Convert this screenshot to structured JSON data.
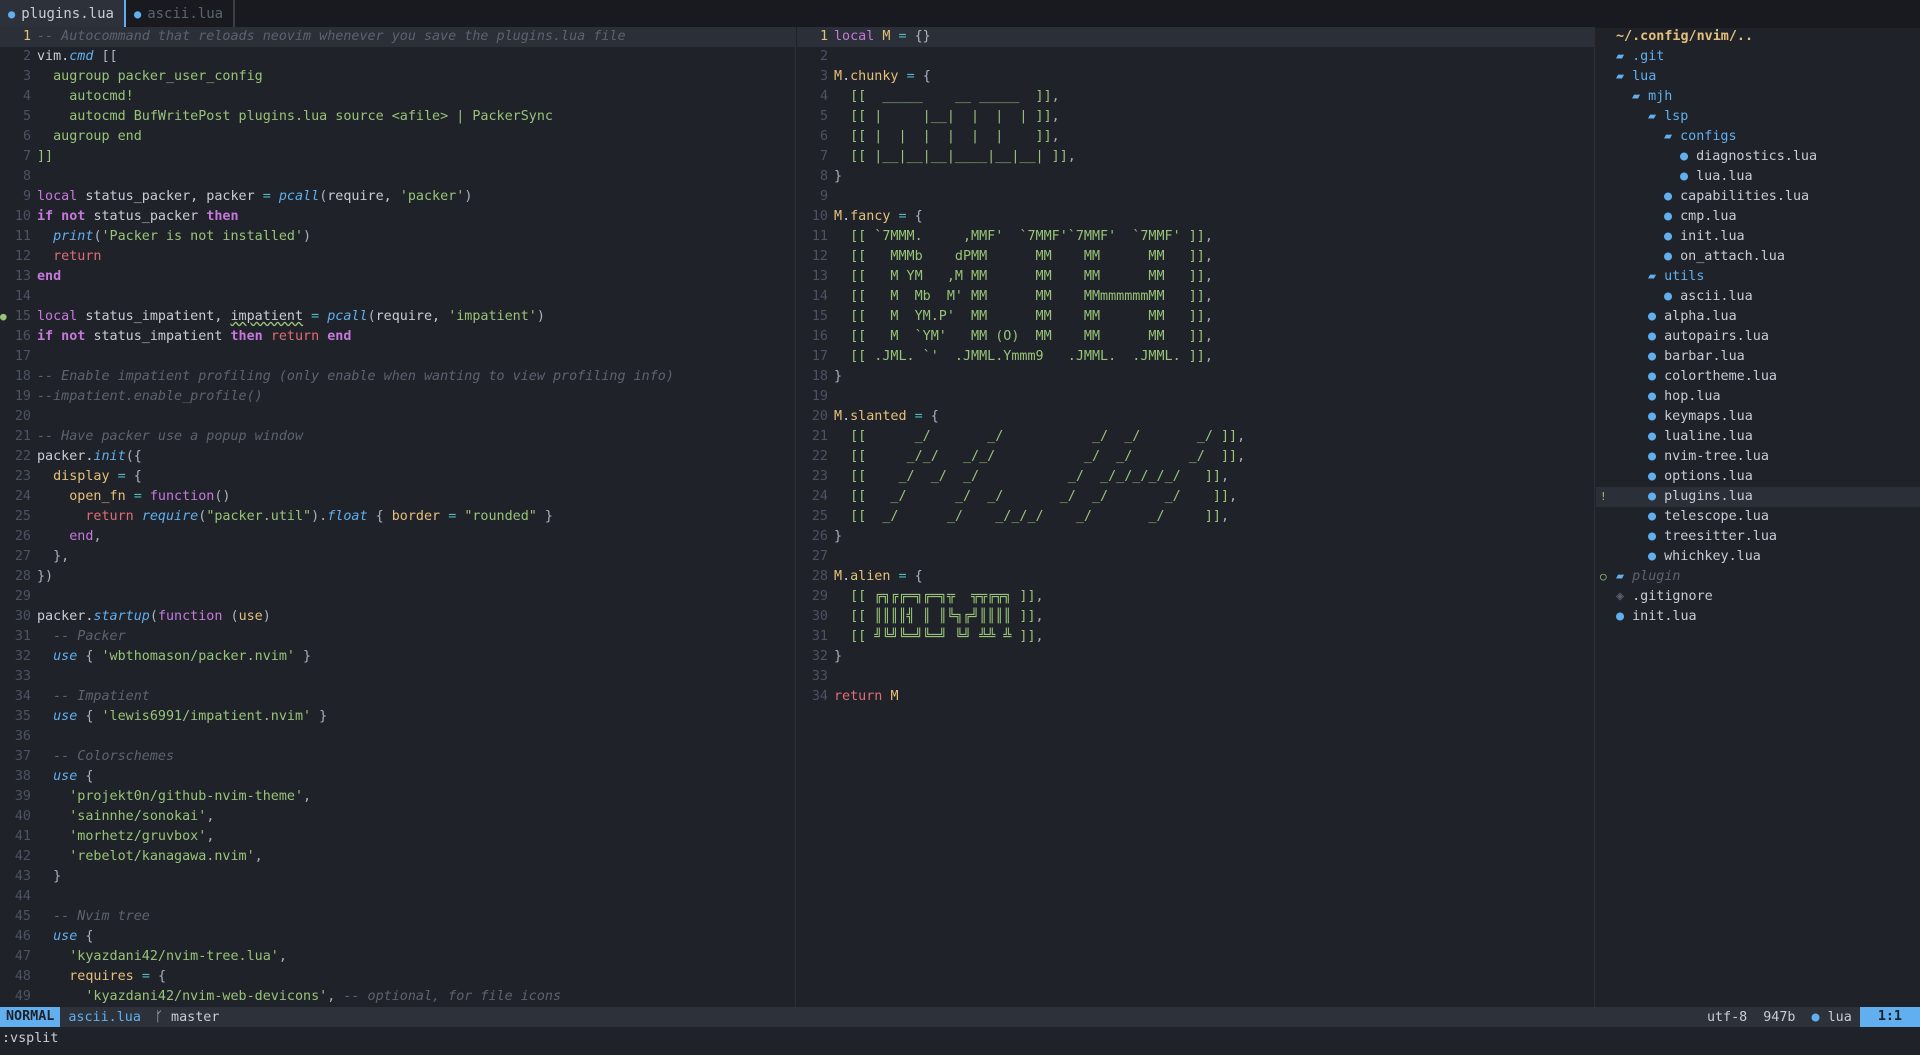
{
  "tabs": [
    {
      "label": "plugins.lua",
      "icon": "lua-icon",
      "active": true
    },
    {
      "label": "ascii.lua",
      "icon": "lua-icon",
      "active": false
    }
  ],
  "left_lines": [
    [
      [
        "c-comment",
        "-- Autocommand that reloads neovim whenever you save the plugins.lua file"
      ]
    ],
    [
      [
        "c-var",
        "vim."
      ],
      [
        "c-fn",
        "cmd"
      ],
      [
        "c-punc",
        " [["
      ]
    ],
    [
      [
        "c-str",
        "  augroup packer_user_config"
      ]
    ],
    [
      [
        "c-str",
        "    autocmd!"
      ]
    ],
    [
      [
        "c-str",
        "    autocmd BufWritePost plugins.lua source <afile> | PackerSync"
      ]
    ],
    [
      [
        "c-str",
        "  augroup end"
      ]
    ],
    [
      [
        "c-str",
        "]]"
      ]
    ],
    [],
    [
      [
        "c-kw",
        "local "
      ],
      [
        "c-var",
        "status_packer, packer "
      ],
      [
        "c-op",
        "= "
      ],
      [
        "c-fn",
        "pcall"
      ],
      [
        "c-punc",
        "("
      ],
      [
        "c-var",
        "require, "
      ],
      [
        "c-str",
        "'packer'"
      ],
      [
        "c-punc",
        ")"
      ]
    ],
    [
      [
        "c-kwb",
        "if not "
      ],
      [
        "c-var",
        "status_packer "
      ],
      [
        "c-kwb",
        "then"
      ]
    ],
    [
      [
        "c-var",
        "  "
      ],
      [
        "c-fn",
        "print"
      ],
      [
        "c-punc",
        "("
      ],
      [
        "c-str",
        "'Packer is not installed'"
      ],
      [
        "c-punc",
        ")"
      ]
    ],
    [
      [
        "c-ret",
        "  return"
      ]
    ],
    [
      [
        "c-kwb",
        "end"
      ]
    ],
    [],
    [
      [
        "c-kw",
        "local "
      ],
      [
        "c-var",
        "status_impatient, "
      ],
      [
        "c-under",
        "impatient"
      ],
      [
        "c-var",
        " "
      ],
      [
        "c-op",
        "= "
      ],
      [
        "c-fn",
        "pcall"
      ],
      [
        "c-punc",
        "("
      ],
      [
        "c-var",
        "require, "
      ],
      [
        "c-str",
        "'impatient'"
      ],
      [
        "c-punc",
        ")"
      ]
    ],
    [
      [
        "c-kwb",
        "if not "
      ],
      [
        "c-var",
        "status_impatient "
      ],
      [
        "c-kwb",
        "then "
      ],
      [
        "c-ret",
        "return "
      ],
      [
        "c-kwb",
        "end"
      ]
    ],
    [],
    [
      [
        "c-comment",
        "-- Enable impatient profiling (only enable when wanting to view profiling info)"
      ]
    ],
    [
      [
        "c-comment",
        "--impatient.enable_profile()"
      ]
    ],
    [],
    [
      [
        "c-comment",
        "-- Have packer use a popup window"
      ]
    ],
    [
      [
        "c-var",
        "packer."
      ],
      [
        "c-fn",
        "init"
      ],
      [
        "c-punc",
        "({"
      ]
    ],
    [
      [
        "c-field",
        "  display "
      ],
      [
        "c-op",
        "= "
      ],
      [
        "c-punc",
        "{"
      ]
    ],
    [
      [
        "c-field",
        "    open_fn "
      ],
      [
        "c-op",
        "= "
      ],
      [
        "c-kw",
        "function"
      ],
      [
        "c-punc",
        "()"
      ]
    ],
    [
      [
        "c-ret",
        "      return "
      ],
      [
        "c-fn",
        "require"
      ],
      [
        "c-punc",
        "("
      ],
      [
        "c-str",
        "\"packer.util\""
      ],
      [
        "c-punc",
        ")."
      ],
      [
        "c-fn",
        "float"
      ],
      [
        "c-punc",
        " { "
      ],
      [
        "c-field",
        "border "
      ],
      [
        "c-op",
        "= "
      ],
      [
        "c-str",
        "\"rounded\""
      ],
      [
        "c-punc",
        " }"
      ]
    ],
    [
      [
        "c-kw",
        "    end"
      ],
      [
        "c-punc",
        ","
      ]
    ],
    [
      [
        "c-punc",
        "  },"
      ]
    ],
    [
      [
        "c-punc",
        "})"
      ]
    ],
    [],
    [
      [
        "c-var",
        "packer."
      ],
      [
        "c-fn",
        "startup"
      ],
      [
        "c-punc",
        "("
      ],
      [
        "c-kw",
        "function "
      ],
      [
        "c-punc",
        "("
      ],
      [
        "c-field",
        "use"
      ],
      [
        "c-punc",
        ")"
      ]
    ],
    [
      [
        "c-comment",
        "  -- Packer"
      ]
    ],
    [
      [
        "c-fn",
        "  use"
      ],
      [
        "c-punc",
        " { "
      ],
      [
        "c-str",
        "'wbthomason/packer.nvim'"
      ],
      [
        "c-punc",
        " }"
      ]
    ],
    [],
    [
      [
        "c-comment",
        "  -- Impatient"
      ]
    ],
    [
      [
        "c-fn",
        "  use"
      ],
      [
        "c-punc",
        " { "
      ],
      [
        "c-str",
        "'lewis6991/impatient.nvim'"
      ],
      [
        "c-punc",
        " }"
      ]
    ],
    [],
    [
      [
        "c-comment",
        "  -- Colorschemes"
      ]
    ],
    [
      [
        "c-fn",
        "  use"
      ],
      [
        "c-punc",
        " {"
      ]
    ],
    [
      [
        "c-str",
        "    'projekt0n/github-nvim-theme'"
      ],
      [
        "c-punc",
        ","
      ]
    ],
    [
      [
        "c-str",
        "    'sainnhe/sonokai'"
      ],
      [
        "c-punc",
        ","
      ]
    ],
    [
      [
        "c-str",
        "    'morhetz/gruvbox'"
      ],
      [
        "c-punc",
        ","
      ]
    ],
    [
      [
        "c-str",
        "    'rebelot/kanagawa.nvim'"
      ],
      [
        "c-punc",
        ","
      ]
    ],
    [
      [
        "c-punc",
        "  }"
      ]
    ],
    [],
    [
      [
        "c-comment",
        "  -- Nvim tree"
      ]
    ],
    [
      [
        "c-fn",
        "  use"
      ],
      [
        "c-punc",
        " {"
      ]
    ],
    [
      [
        "c-str",
        "    'kyazdani42/nvim-tree.lua'"
      ],
      [
        "c-punc",
        ","
      ]
    ],
    [
      [
        "c-field",
        "    requires "
      ],
      [
        "c-op",
        "= "
      ],
      [
        "c-punc",
        "{"
      ]
    ],
    [
      [
        "c-str",
        "      'kyazdani42/nvim-web-devicons'"
      ],
      [
        "c-punc",
        ", "
      ],
      [
        "c-comment",
        "-- optional, for file icons"
      ]
    ]
  ],
  "left_current_line": 1,
  "left_sign_line": 15,
  "mid_lines": [
    [
      [
        "c-kw",
        "local "
      ],
      [
        "c-mod",
        "M "
      ],
      [
        "c-op",
        "= "
      ],
      [
        "c-punc",
        "{}"
      ]
    ],
    [],
    [
      [
        "c-mod",
        "M"
      ],
      [
        "c-var",
        "."
      ],
      [
        "c-field",
        "chunky "
      ],
      [
        "c-op",
        "= "
      ],
      [
        "c-punc",
        "{"
      ]
    ],
    [
      [
        "c-str",
        "  [[  _____    __ _____  ]]"
      ],
      [
        "c-punc",
        ","
      ]
    ],
    [
      [
        "c-str",
        "  [[ |     |__|  |  |  | ]]"
      ],
      [
        "c-punc",
        ","
      ]
    ],
    [
      [
        "c-str",
        "  [[ |  |  |  |  |  |    ]]"
      ],
      [
        "c-punc",
        ","
      ]
    ],
    [
      [
        "c-str",
        "  [[ |__|__|__|____|__|__| ]]"
      ],
      [
        "c-punc",
        ","
      ]
    ],
    [
      [
        "c-punc",
        "}"
      ]
    ],
    [],
    [
      [
        "c-mod",
        "M"
      ],
      [
        "c-var",
        "."
      ],
      [
        "c-field",
        "fancy "
      ],
      [
        "c-op",
        "= "
      ],
      [
        "c-punc",
        "{"
      ]
    ],
    [
      [
        "c-str",
        "  [[ `7MMM.     ,MMF'  `7MMF'`7MMF'  `7MMF' ]]"
      ],
      [
        "c-punc",
        ","
      ]
    ],
    [
      [
        "c-str",
        "  [[   MMMb    dPMM      MM    MM      MM   ]]"
      ],
      [
        "c-punc",
        ","
      ]
    ],
    [
      [
        "c-str",
        "  [[   M YM   ,M MM      MM    MM      MM   ]]"
      ],
      [
        "c-punc",
        ","
      ]
    ],
    [
      [
        "c-str",
        "  [[   M  Mb  M' MM      MM    MMmmmmmmMM   ]]"
      ],
      [
        "c-punc",
        ","
      ]
    ],
    [
      [
        "c-str",
        "  [[   M  YM.P'  MM      MM    MM      MM   ]]"
      ],
      [
        "c-punc",
        ","
      ]
    ],
    [
      [
        "c-str",
        "  [[   M  `YM'   MM (O)  MM    MM      MM   ]]"
      ],
      [
        "c-punc",
        ","
      ]
    ],
    [
      [
        "c-str",
        "  [[ .JML. `'  .JMML.Ymmm9   .JMML.  .JMML. ]]"
      ],
      [
        "c-punc",
        ","
      ]
    ],
    [
      [
        "c-punc",
        "}"
      ]
    ],
    [],
    [
      [
        "c-mod",
        "M"
      ],
      [
        "c-var",
        "."
      ],
      [
        "c-field",
        "slanted "
      ],
      [
        "c-op",
        "= "
      ],
      [
        "c-punc",
        "{"
      ]
    ],
    [
      [
        "c-str",
        "  [[      _/       _/           _/  _/       _/ ]]"
      ],
      [
        "c-punc",
        ","
      ]
    ],
    [
      [
        "c-str",
        "  [[     _/_/   _/_/           _/  _/       _/  ]]"
      ],
      [
        "c-punc",
        ","
      ]
    ],
    [
      [
        "c-str",
        "  [[    _/  _/  _/           _/  _/_/_/_/_/   ]]"
      ],
      [
        "c-punc",
        ","
      ]
    ],
    [
      [
        "c-str",
        "  [[   _/      _/  _/       _/  _/       _/    ]]"
      ],
      [
        "c-punc",
        ","
      ]
    ],
    [
      [
        "c-str",
        "  [[  _/      _/    _/_/_/    _/       _/     ]]"
      ],
      [
        "c-punc",
        ","
      ]
    ],
    [
      [
        "c-punc",
        "}"
      ]
    ],
    [],
    [
      [
        "c-mod",
        "M"
      ],
      [
        "c-var",
        "."
      ],
      [
        "c-field",
        "alien "
      ],
      [
        "c-op",
        "= "
      ],
      [
        "c-punc",
        "{"
      ]
    ],
    [
      [
        "c-str",
        "  [[ ╔╗╔╔═╗╔═╗╦  ╦╦╔╦╗ ]]"
      ],
      [
        "c-punc",
        ","
      ]
    ],
    [
      [
        "c-str",
        "  [[ ║║║║╣ ║ ║╚╗╔╝║║║║ ]]"
      ],
      [
        "c-punc",
        ","
      ]
    ],
    [
      [
        "c-str",
        "  [[ ╝╚╝╚═╝╚═╝ ╚╝ ╩╩ ╩ ]]"
      ],
      [
        "c-punc",
        ","
      ]
    ],
    [
      [
        "c-punc",
        "}"
      ]
    ],
    [],
    [
      [
        "c-ret",
        "return "
      ],
      [
        "c-mod",
        "M"
      ]
    ]
  ],
  "mid_current_line": 1,
  "tree": [
    {
      "label": "~/.config/nvim/..",
      "depth": 0,
      "kind": "root"
    },
    {
      "label": ".git",
      "depth": 0,
      "kind": "dir"
    },
    {
      "label": "lua",
      "depth": 0,
      "kind": "dir-open"
    },
    {
      "label": "mjh",
      "depth": 1,
      "kind": "dir-open"
    },
    {
      "label": "lsp",
      "depth": 2,
      "kind": "dir-open"
    },
    {
      "label": "configs",
      "depth": 3,
      "kind": "dir-open"
    },
    {
      "label": "diagnostics.lua",
      "depth": 4,
      "kind": "file"
    },
    {
      "label": "lua.lua",
      "depth": 4,
      "kind": "file"
    },
    {
      "label": "capabilities.lua",
      "depth": 3,
      "kind": "file"
    },
    {
      "label": "cmp.lua",
      "depth": 3,
      "kind": "file"
    },
    {
      "label": "init.lua",
      "depth": 3,
      "kind": "file"
    },
    {
      "label": "on_attach.lua",
      "depth": 3,
      "kind": "file"
    },
    {
      "label": "utils",
      "depth": 2,
      "kind": "dir-open"
    },
    {
      "label": "ascii.lua",
      "depth": 3,
      "kind": "file"
    },
    {
      "label": "alpha.lua",
      "depth": 2,
      "kind": "file"
    },
    {
      "label": "autopairs.lua",
      "depth": 2,
      "kind": "file"
    },
    {
      "label": "barbar.lua",
      "depth": 2,
      "kind": "file"
    },
    {
      "label": "colortheme.lua",
      "depth": 2,
      "kind": "file"
    },
    {
      "label": "hop.lua",
      "depth": 2,
      "kind": "file"
    },
    {
      "label": "keymaps.lua",
      "depth": 2,
      "kind": "file"
    },
    {
      "label": "lualine.lua",
      "depth": 2,
      "kind": "file"
    },
    {
      "label": "nvim-tree.lua",
      "depth": 2,
      "kind": "file"
    },
    {
      "label": "options.lua",
      "depth": 2,
      "kind": "file"
    },
    {
      "label": "plugins.lua",
      "depth": 2,
      "kind": "file",
      "current": true,
      "sign": "!"
    },
    {
      "label": "telescope.lua",
      "depth": 2,
      "kind": "file"
    },
    {
      "label": "treesitter.lua",
      "depth": 2,
      "kind": "file"
    },
    {
      "label": "whichkey.lua",
      "depth": 2,
      "kind": "file"
    },
    {
      "label": "plugin",
      "depth": 0,
      "kind": "dir-ignored",
      "sign": "○"
    },
    {
      "label": ".gitignore",
      "depth": 0,
      "kind": "git",
      "sign": ""
    },
    {
      "label": "init.lua",
      "depth": 0,
      "kind": "file"
    }
  ],
  "status": {
    "mode": "NORMAL",
    "file": "ascii.lua",
    "branch": "master",
    "encoding": "utf-8",
    "size": "947b",
    "filetype": "lua",
    "position": "1:1"
  },
  "cmdline": ":vsplit",
  "colors": {
    "accent": "#61afef",
    "bg": "#1f2228",
    "string": "#98c379",
    "keyword": "#c678dd"
  }
}
